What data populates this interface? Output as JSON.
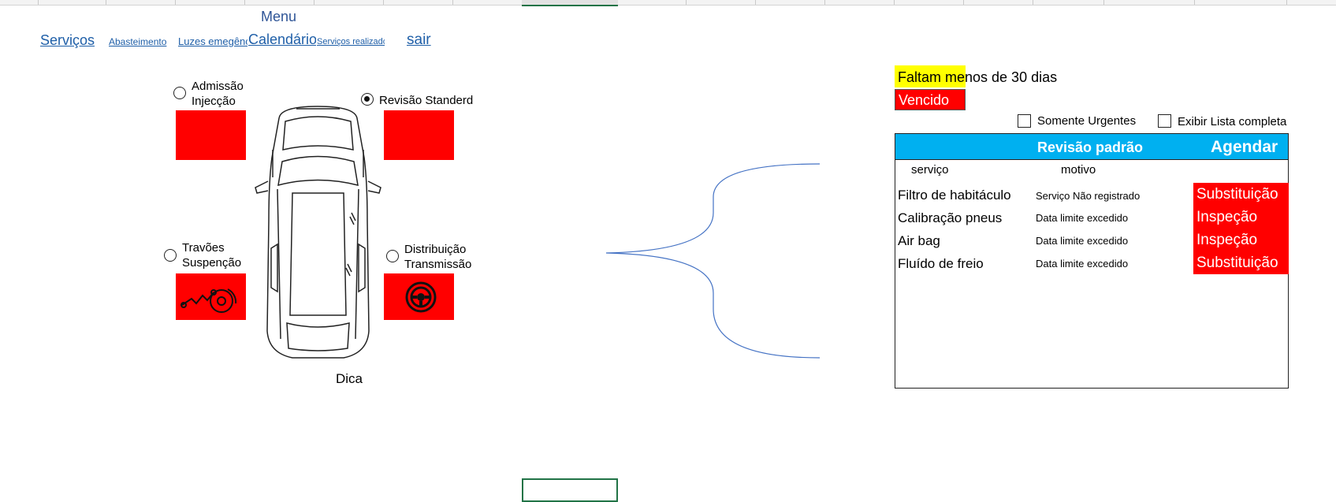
{
  "menu": {
    "title": "Menu",
    "links": [
      {
        "label": "Serviços"
      },
      {
        "label": "Abasteimento"
      },
      {
        "label": "Luzes emegência"
      },
      {
        "label": "Calendário"
      },
      {
        "label": "Serviços realizados"
      },
      {
        "label": "sair"
      }
    ]
  },
  "car_panel": {
    "options": [
      {
        "label": "Admissão\nInjecção",
        "checked": false
      },
      {
        "label": "Revisão Standerd",
        "checked": true
      },
      {
        "label": "Travões\nSuspenção",
        "checked": false
      },
      {
        "label": "Distribuição\nTransmissão",
        "checked": false
      }
    ],
    "dica_label": "Dica",
    "icons": [
      "brake-suspension-icon",
      "steering-wheel-icon",
      "car-top-view-icon"
    ]
  },
  "legend": {
    "warning": "Faltam menos de 30 dias",
    "expired": "Vencido"
  },
  "filters": {
    "urgent_only": {
      "label": "Somente Urgentes",
      "checked": false
    },
    "full_list": {
      "label": "Exibir Lista completa",
      "checked": false
    }
  },
  "revision_panel": {
    "title": "Revisão padrão",
    "schedule_button": "Agendar",
    "col_service": "serviço",
    "col_reason": "motivo",
    "rows": [
      {
        "service": "Filtro de habitáculo",
        "reason": "Serviço Não registrado",
        "action": "Substituição"
      },
      {
        "service": "Calibração pneus",
        "reason": "Data limite excedido",
        "action": "Inspeção"
      },
      {
        "service": "Air bag",
        "reason": "Data limite excedido",
        "action": "Inspeção"
      },
      {
        "service": "Fluído de freio",
        "reason": "Data limite excedido",
        "action": "Substituição"
      }
    ]
  },
  "colors": {
    "header_blue": "#00b0f0",
    "alert_red": "#ff0000",
    "warning_yellow": "#ffff00",
    "link_blue": "#1f5fa8"
  }
}
